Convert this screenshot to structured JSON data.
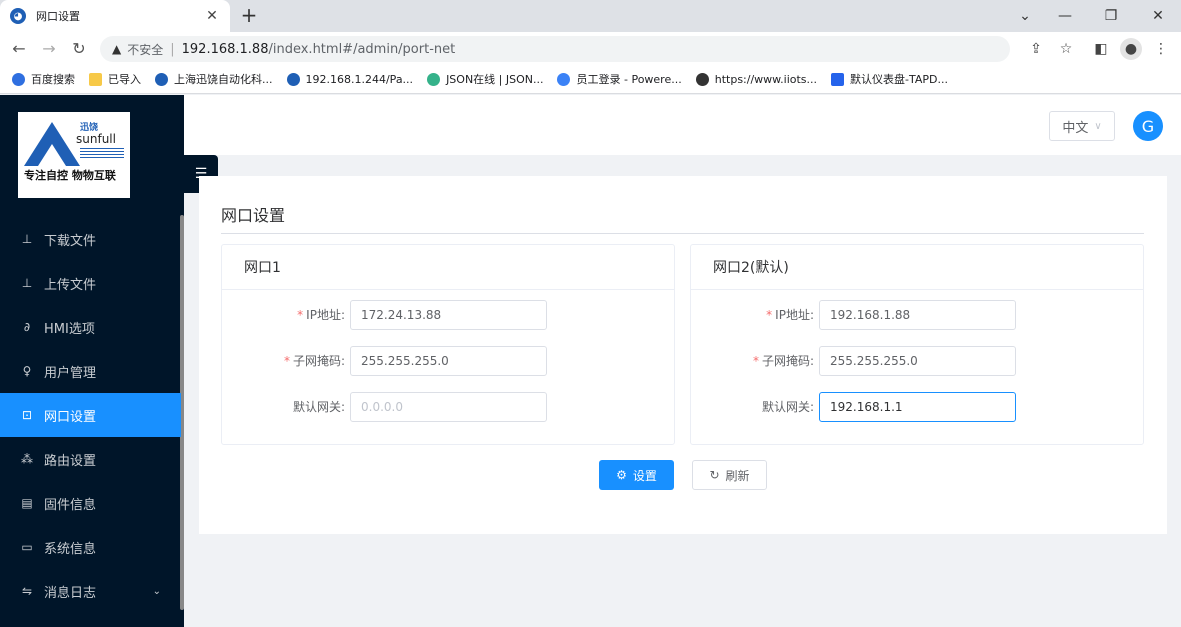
{
  "browser": {
    "tab_title": "网口设置",
    "insecure_label": "不安全",
    "url_host": "192.168.1.88",
    "url_path": "/index.html#/admin/port-net",
    "bookmarks": [
      {
        "label": "百度搜索",
        "color": "#2f6fe0"
      },
      {
        "label": "已导入",
        "color": "#f7c948"
      },
      {
        "label": "上海迅饶自动化科...",
        "color": "#1f5fb5"
      },
      {
        "label": "192.168.1.244/Pa...",
        "color": "#1f5fb5"
      },
      {
        "label": "JSON在线 | JSON...",
        "color": "#35b28a"
      },
      {
        "label": "员工登录 - Powere...",
        "color": "#3b82f6"
      },
      {
        "label": "https://www.iiots...",
        "color": "#333333"
      },
      {
        "label": "默认仪表盘-TAPD...",
        "color": "#2563eb"
      }
    ]
  },
  "sidebar": {
    "logo": {
      "cn": "迅饶",
      "en": "sunfull",
      "slogan": "专注自控 物物互联"
    },
    "items": [
      {
        "label": "下载文件",
        "icon": "download-icon"
      },
      {
        "label": "上传文件",
        "icon": "upload-icon"
      },
      {
        "label": "HMI选项",
        "icon": "link-icon"
      },
      {
        "label": "用户管理",
        "icon": "user-icon"
      },
      {
        "label": "网口设置",
        "icon": "network-icon",
        "active": true
      },
      {
        "label": "路由设置",
        "icon": "route-icon"
      },
      {
        "label": "固件信息",
        "icon": "document-icon"
      },
      {
        "label": "系统信息",
        "icon": "monitor-icon"
      },
      {
        "label": "消息日志",
        "icon": "exchange-icon",
        "has_submenu": true
      }
    ]
  },
  "header": {
    "language": "中文",
    "avatar_letter": "G"
  },
  "page": {
    "title": "网口设置",
    "port1": {
      "title": "网口1",
      "ip_label": "IP地址:",
      "ip_value": "172.24.13.88",
      "mask_label": "子网掩码:",
      "mask_value": "255.255.255.0",
      "gateway_label": "默认网关:",
      "gateway_value": "",
      "gateway_placeholder": "0.0.0.0"
    },
    "port2": {
      "title": "网口2(默认)",
      "ip_label": "IP地址:",
      "ip_value": "192.168.1.88",
      "mask_label": "子网掩码:",
      "mask_value": "255.255.255.0",
      "gateway_label": "默认网关:",
      "gateway_value": "192.168.1.1"
    },
    "set_label": "设置",
    "refresh_label": "刷新"
  },
  "colors": {
    "accent": "#1890ff",
    "sidebar_bg": "#001529",
    "required": "#f56c6c"
  }
}
